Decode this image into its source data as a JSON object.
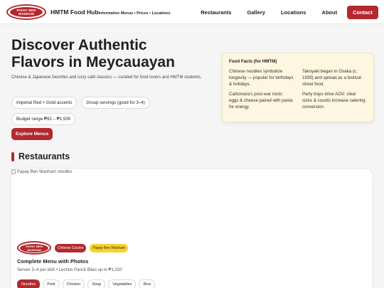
{
  "nav": {
    "logo_text": "PAPAY BEN WANHAM",
    "brand_title": "HMTM Food Hub",
    "brand_subtitle": "Informative Menus • Prices • Locations",
    "links": [
      "Restaurants",
      "Gallery",
      "Locations",
      "About"
    ],
    "contact_label": "Contact"
  },
  "hero": {
    "title_line1": "Discover Authentic",
    "title_line2": "Flavors in Meycauayan",
    "description": "Chinese & Japanese favorites and cozy café classics — curated for food lovers and HMTM students.",
    "chips": [
      "Imperial Red + Gold accents",
      "Group servings (good for 3–4)",
      "Budget range ₱92 – ₱1,500"
    ],
    "cta_label": "Explore Menus"
  },
  "facts": {
    "title": "Food Facts (for HMTM)",
    "items": [
      "Chinese noodles symbolize longevity — popular for birthdays & holidays.",
      "Takoyaki began in Osaka (c. 1935) and spread as a festival street food.",
      "Carbonara's post-war roots: eggs & cheese paired with pasta for energy.",
      "Party trays drive AOV: clear sizes & counts increase catering conversion."
    ]
  },
  "restaurants": {
    "section_title": "Restaurants",
    "card": {
      "image_alt": "Papay Ben Wanham noodles",
      "logo_text": "PAPAY BEN WANHAM",
      "tags": [
        "Chinese Cuisine",
        "Papay Ben Wanham"
      ],
      "title": "Complete Menu with Photos",
      "subtitle": "Serves 3–4 per dish • Lechon Pancit Bilao up to ₱1,020",
      "filters": [
        "Noodles",
        "Pork",
        "Chicken",
        "Soup",
        "Vegetables",
        "Rice"
      ],
      "active_filter": "Noodles"
    }
  },
  "colors": {
    "accent": "#b3292e",
    "gold": "#f7d12e",
    "facts_bg": "#fdf6e0"
  }
}
